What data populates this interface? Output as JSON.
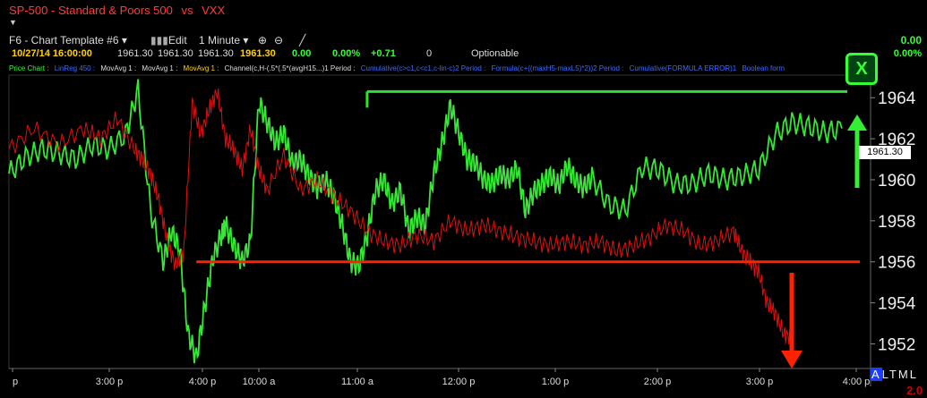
{
  "header": {
    "symbol": "SP-500",
    "name": "Standard & Poors 500",
    "vs": "vs",
    "compare": "VXX",
    "menu_caret": "▼"
  },
  "toolbar": {
    "template": "F6 - Chart Template #6 ▾",
    "edit": "Edit",
    "interval": "1 Minute ▾"
  },
  "quote": {
    "datetime": "10/27/14 16:00:00",
    "open": "1961.30",
    "high": "1961.30",
    "low": "1961.30",
    "close": "1961.30",
    "change": "0.00",
    "pct": "0.00%",
    "diff": "+0.71",
    "vol": "0",
    "optionable": "Optionable",
    "right_top": "0.00",
    "right_pct": "0.00%"
  },
  "legend": {
    "items": [
      "Price Chart :",
      "LinReg 450 :",
      "MovAvg 1 :",
      "MovAvg 1 :",
      "MovAvg 1 :",
      "Channel(c,H-(.5*(.5*(avgH15...)1 Period :",
      "Cumulative(c>c1,c<c1,c-lin-c)2 Period :",
      "Formula(c+((maxH5-maxL5)*2))2 Period :",
      "Cumulative(FORMULA ERROR)1",
      "Boolean form"
    ]
  },
  "badge": {
    "x_label": "X"
  },
  "price_box": "1961.30",
  "corner": {
    "a": "A",
    "rest": "LTML",
    "two": "2.0"
  },
  "chart_data": {
    "type": "line",
    "title": "SP-500 - Standard & Poors 500 vs VXX",
    "y_ticks": [
      1964,
      1962,
      1960,
      1958,
      1956,
      1954,
      1952
    ],
    "ylim": [
      1950.8,
      1965.1
    ],
    "x_ticks": [
      "p",
      "3:00 p",
      "4:00 p",
      "10:00 a",
      "11:00 a",
      "12:00 p",
      "1:00 p",
      "2:00 p",
      "3:00 p",
      "4:00 p"
    ],
    "grid": false,
    "series": [
      {
        "name": "SP-500",
        "color": "#34e834",
        "x_frac": [
          0.0,
          0.02,
          0.04,
          0.06,
          0.08,
          0.1,
          0.12,
          0.14,
          0.155,
          0.17,
          0.185,
          0.195,
          0.205,
          0.215,
          0.225,
          0.235,
          0.245,
          0.255,
          0.26,
          0.27,
          0.28,
          0.29,
          0.3,
          0.31,
          0.32,
          0.33,
          0.34,
          0.35,
          0.36,
          0.37,
          0.38,
          0.39,
          0.4,
          0.41,
          0.42,
          0.43,
          0.44,
          0.45,
          0.46,
          0.47,
          0.48,
          0.49,
          0.5,
          0.51,
          0.52,
          0.53,
          0.54,
          0.55,
          0.56,
          0.57,
          0.58,
          0.59,
          0.6,
          0.61,
          0.62,
          0.63,
          0.64,
          0.65,
          0.66,
          0.67,
          0.68,
          0.69,
          0.7,
          0.72,
          0.74,
          0.76,
          0.78,
          0.8,
          0.82,
          0.84,
          0.86,
          0.88,
          0.9,
          0.92,
          0.94,
          0.96,
          0.98,
          1.0
        ],
        "values": [
          1960.3,
          1961.1,
          1961.5,
          1961.3,
          1961.0,
          1961.7,
          1961.5,
          1962.2,
          1964.4,
          1958.5,
          1956.0,
          1957.5,
          1956.6,
          1952.5,
          1951.3,
          1953.8,
          1956.2,
          1957.3,
          1957.8,
          1956.8,
          1956.0,
          1957.0,
          1963.8,
          1962.8,
          1961.8,
          1962.3,
          1960.8,
          1961.0,
          1960.2,
          1959.6,
          1960.0,
          1959.2,
          1957.8,
          1956.0,
          1955.8,
          1957.3,
          1959.5,
          1960.0,
          1958.8,
          1959.5,
          1957.5,
          1958.2,
          1957.8,
          1960.3,
          1961.8,
          1963.6,
          1962.3,
          1961.0,
          1960.8,
          1960.0,
          1959.8,
          1960.3,
          1960.0,
          1960.6,
          1958.5,
          1959.4,
          1959.8,
          1960.2,
          1959.7,
          1960.7,
          1960.0,
          1959.6,
          1960.1,
          1958.8,
          1958.5,
          1960.6,
          1960.5,
          1959.8,
          1959.8,
          1960.3,
          1960.0,
          1960.2,
          1960.5,
          1962.2,
          1962.8,
          1962.6,
          1962.3,
          1962.5
        ]
      },
      {
        "name": "VXX",
        "color": "#e01010",
        "x_frac": [
          0.0,
          0.03,
          0.06,
          0.09,
          0.11,
          0.13,
          0.15,
          0.16,
          0.17,
          0.18,
          0.19,
          0.2,
          0.21,
          0.22,
          0.23,
          0.24,
          0.25,
          0.26,
          0.27,
          0.28,
          0.29,
          0.3,
          0.31,
          0.33,
          0.35,
          0.37,
          0.39,
          0.41,
          0.43,
          0.45,
          0.47,
          0.49,
          0.51,
          0.53,
          0.55,
          0.57,
          0.59,
          0.61,
          0.63,
          0.65,
          0.67,
          0.69,
          0.71,
          0.73,
          0.75,
          0.77,
          0.79,
          0.81,
          0.83,
          0.85,
          0.87,
          0.88,
          0.89,
          0.9,
          0.91,
          0.92,
          0.93,
          0.94
        ],
        "values": [
          1961.5,
          1962.5,
          1961.7,
          1962.5,
          1962.0,
          1963.0,
          1961.5,
          1961.0,
          1960.3,
          1959.0,
          1957.0,
          1955.8,
          1956.5,
          1963.8,
          1962.2,
          1963.4,
          1964.3,
          1962.0,
          1961.5,
          1960.5,
          1962.5,
          1960.5,
          1959.5,
          1961.2,
          1959.5,
          1960.0,
          1959.2,
          1958.5,
          1957.5,
          1957.0,
          1956.8,
          1957.3,
          1957.0,
          1958.0,
          1957.5,
          1957.8,
          1957.5,
          1957.2,
          1957.0,
          1956.8,
          1957.0,
          1956.8,
          1957.0,
          1956.5,
          1956.8,
          1957.2,
          1957.8,
          1957.5,
          1956.8,
          1957.0,
          1957.5,
          1956.5,
          1956.0,
          1955.5,
          1954.0,
          1953.5,
          1952.5,
          1952.3
        ]
      }
    ],
    "annotations": [
      {
        "type": "hline",
        "color": "#33dd33",
        "y": 1964.3,
        "from_frac": 0.43,
        "to_frac": 1.0
      },
      {
        "type": "hline",
        "color": "#ff2200",
        "y": 1956.0,
        "from_frac": 0.225,
        "to_frac": 1.05
      },
      {
        "type": "arrow-up",
        "color": "#33ee33"
      },
      {
        "type": "arrow-down",
        "color": "#ff2200"
      }
    ]
  }
}
